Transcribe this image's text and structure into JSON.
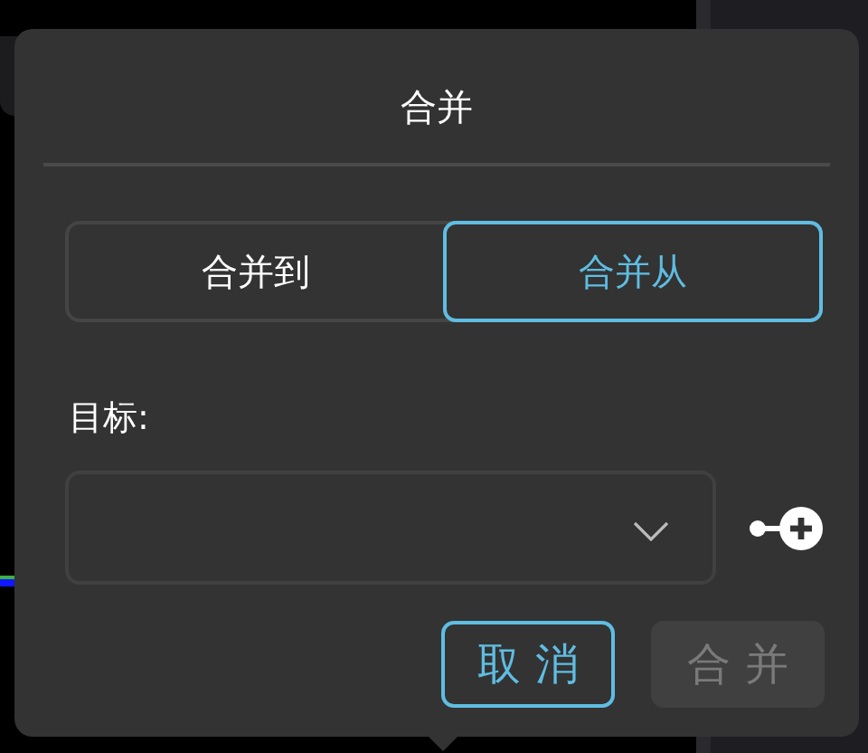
{
  "dialog": {
    "title": "合并"
  },
  "tabs": [
    {
      "label": "合并到",
      "selected": false
    },
    {
      "label": "合并从",
      "selected": true
    }
  ],
  "target": {
    "label": "目标:"
  },
  "buttons": [
    {
      "label": "取 消",
      "disabled": false
    },
    {
      "label": "合 并",
      "disabled": true
    }
  ]
}
